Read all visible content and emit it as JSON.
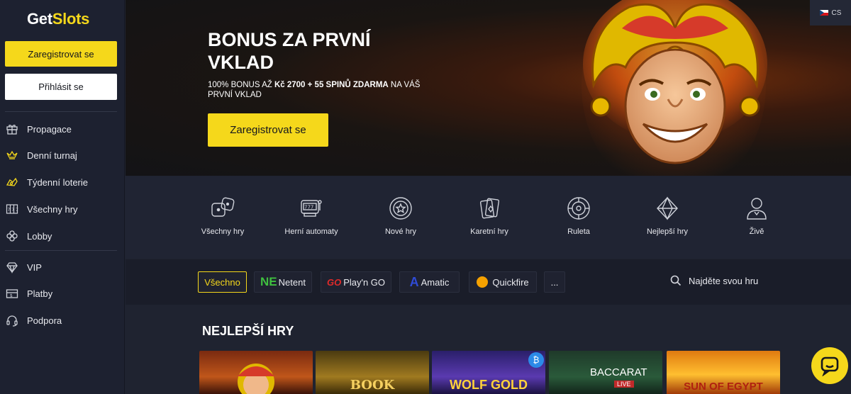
{
  "brand": {
    "logo_main": "Get",
    "logo_accent": "Slots"
  },
  "sidebar": {
    "register_label": "Zaregistrovat se",
    "login_label": "Přihlásit se",
    "items": [
      {
        "label": "Propagace",
        "icon": "gift-icon"
      },
      {
        "label": "Denní turnaj",
        "icon": "crown-icon"
      },
      {
        "label": "Týdenní loterie",
        "icon": "lottery-icon"
      },
      {
        "label": "Všechny hry",
        "icon": "slot-777-icon"
      },
      {
        "label": "Lobby",
        "icon": "clover-icon"
      },
      {
        "label": "VIP",
        "icon": "diamond-icon"
      },
      {
        "label": "Platby",
        "icon": "payment-icon"
      },
      {
        "label": "Podpora",
        "icon": "headset-icon"
      }
    ]
  },
  "language": {
    "code": "CS"
  },
  "hero": {
    "title": "BONUS ZA PRVNÍ VKLAD",
    "subtitle_prefix": "100% BONUS AŽ ",
    "subtitle_bold": "Kč 2700 + 55 SPINŮ ZDARMA",
    "subtitle_suffix": " NA VÁŠ PRVNÍ VKLAD",
    "button_label": "Zaregistrovat se"
  },
  "categories": [
    {
      "label": "Všechny hry",
      "icon": "dice-icon"
    },
    {
      "label": "Herní automaty",
      "icon": "slot-machine-icon"
    },
    {
      "label": "Nové hry",
      "icon": "star-chip-icon"
    },
    {
      "label": "Karetní hry",
      "icon": "cards-icon"
    },
    {
      "label": "Ruleta",
      "icon": "roulette-icon"
    },
    {
      "label": "Nejlepší hry",
      "icon": "diamond-icon"
    },
    {
      "label": "Živě",
      "icon": "live-dealer-icon"
    }
  ],
  "providers": {
    "items": [
      {
        "label": "Všechno",
        "mark": ""
      },
      {
        "label": "Netent",
        "mark": "NE"
      },
      {
        "label": "Play'n GO",
        "mark": "GO"
      },
      {
        "label": "Amatic",
        "mark": "A"
      },
      {
        "label": "Quickfire",
        "mark": ""
      },
      {
        "label": "...",
        "mark": ""
      }
    ],
    "search_label": "Najděte svou hru"
  },
  "best_games": {
    "title": "NEJLEPŠÍ HRY",
    "tiles": [
      {
        "name": ""
      },
      {
        "name": "BOOK"
      },
      {
        "name": "WOLF GOLD",
        "badge": "₿"
      },
      {
        "name": "BACCARAT",
        "sub": "LIVE"
      },
      {
        "name": "SUN OF EGYPT"
      }
    ]
  },
  "colors": {
    "accent": "#f5d81b",
    "sidebar_bg": "#1d2130",
    "page_bg": "#1f2330"
  }
}
